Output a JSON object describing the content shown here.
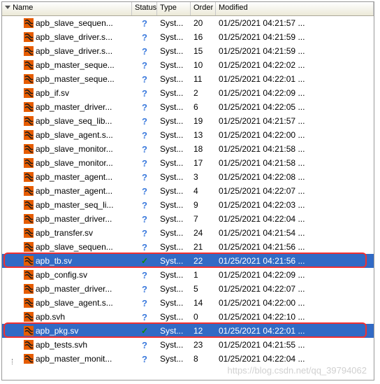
{
  "columns": {
    "name": "Name",
    "status": "Status",
    "type": "Type",
    "order": "Order",
    "modified": "Modified"
  },
  "file_icon_colors": {
    "bg": "#e65c00",
    "fg": "#1a1a1a"
  },
  "rows": [
    {
      "name": "apb_slave_sequen...",
      "status": "?",
      "type": "Syst...",
      "order": "20",
      "modified": "01/25/2021 04:21:57 ...",
      "sel": false
    },
    {
      "name": "apb_slave_driver.s...",
      "status": "?",
      "type": "Syst...",
      "order": "16",
      "modified": "01/25/2021 04:21:59 ...",
      "sel": false
    },
    {
      "name": "apb_slave_driver.s...",
      "status": "?",
      "type": "Syst...",
      "order": "15",
      "modified": "01/25/2021 04:21:59 ...",
      "sel": false
    },
    {
      "name": "apb_master_seque...",
      "status": "?",
      "type": "Syst...",
      "order": "10",
      "modified": "01/25/2021 04:22:02 ...",
      "sel": false
    },
    {
      "name": "apb_master_seque...",
      "status": "?",
      "type": "Syst...",
      "order": "11",
      "modified": "01/25/2021 04:22:01 ...",
      "sel": false
    },
    {
      "name": "apb_if.sv",
      "status": "?",
      "type": "Syst...",
      "order": "2",
      "modified": "01/25/2021 04:22:09 ...",
      "sel": false
    },
    {
      "name": "apb_master_driver...",
      "status": "?",
      "type": "Syst...",
      "order": "6",
      "modified": "01/25/2021 04:22:05 ...",
      "sel": false
    },
    {
      "name": "apb_slave_seq_lib...",
      "status": "?",
      "type": "Syst...",
      "order": "19",
      "modified": "01/25/2021 04:21:57 ...",
      "sel": false
    },
    {
      "name": "apb_slave_agent.s...",
      "status": "?",
      "type": "Syst...",
      "order": "13",
      "modified": "01/25/2021 04:22:00 ...",
      "sel": false
    },
    {
      "name": "apb_slave_monitor...",
      "status": "?",
      "type": "Syst...",
      "order": "18",
      "modified": "01/25/2021 04:21:58 ...",
      "sel": false
    },
    {
      "name": "apb_slave_monitor...",
      "status": "?",
      "type": "Syst...",
      "order": "17",
      "modified": "01/25/2021 04:21:58 ...",
      "sel": false
    },
    {
      "name": "apb_master_agent...",
      "status": "?",
      "type": "Syst...",
      "order": "3",
      "modified": "01/25/2021 04:22:08 ...",
      "sel": false
    },
    {
      "name": "apb_master_agent...",
      "status": "?",
      "type": "Syst...",
      "order": "4",
      "modified": "01/25/2021 04:22:07 ...",
      "sel": false
    },
    {
      "name": "apb_master_seq_li...",
      "status": "?",
      "type": "Syst...",
      "order": "9",
      "modified": "01/25/2021 04:22:03 ...",
      "sel": false
    },
    {
      "name": "apb_master_driver...",
      "status": "?",
      "type": "Syst...",
      "order": "7",
      "modified": "01/25/2021 04:22:04 ...",
      "sel": false
    },
    {
      "name": "apb_transfer.sv",
      "status": "?",
      "type": "Syst...",
      "order": "24",
      "modified": "01/25/2021 04:21:54 ...",
      "sel": false
    },
    {
      "name": "apb_slave_sequen...",
      "status": "?",
      "type": "Syst...",
      "order": "21",
      "modified": "01/25/2021 04:21:56 ...",
      "sel": false
    },
    {
      "name": "apb_tb.sv",
      "status": "✓",
      "type": "Syst...",
      "order": "22",
      "modified": "01/25/2021 04:21:56 ...",
      "sel": true,
      "hl": true
    },
    {
      "name": "apb_config.sv",
      "status": "?",
      "type": "Syst...",
      "order": "1",
      "modified": "01/25/2021 04:22:09 ...",
      "sel": false
    },
    {
      "name": "apb_master_driver...",
      "status": "?",
      "type": "Syst...",
      "order": "5",
      "modified": "01/25/2021 04:22:07 ...",
      "sel": false
    },
    {
      "name": "apb_slave_agent.s...",
      "status": "?",
      "type": "Syst...",
      "order": "14",
      "modified": "01/25/2021 04:22:00 ...",
      "sel": false
    },
    {
      "name": "apb.svh",
      "status": "?",
      "type": "Syst...",
      "order": "0",
      "modified": "01/25/2021 04:22:10 ...",
      "sel": false
    },
    {
      "name": "apb_pkg.sv",
      "status": "✓",
      "type": "Syst...",
      "order": "12",
      "modified": "01/25/2021 04:22:01 ...",
      "sel": true,
      "hl": true
    },
    {
      "name": "apb_tests.svh",
      "status": "?",
      "type": "Syst...",
      "order": "23",
      "modified": "01/25/2021 04:21:55 ...",
      "sel": false
    },
    {
      "name": "apb_master_monit...",
      "status": "?",
      "type": "Syst...",
      "order": "8",
      "modified": "01/25/2021 04:22:04 ...",
      "sel": false
    }
  ],
  "watermark": "https://blog.csdn.net/qq_39794062"
}
